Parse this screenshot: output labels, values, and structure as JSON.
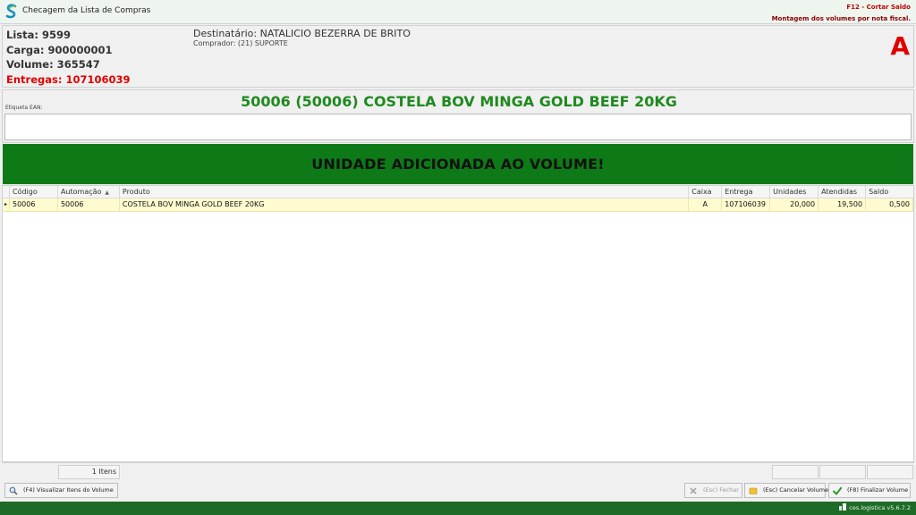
{
  "window": {
    "title": "Checagem da Lista de Compras",
    "hint_shortcut": "F12 - Cortar Saldo",
    "hint_mode": "Montagem dos volumes por nota fiscal."
  },
  "info": {
    "lista": "Lista: 9599",
    "carga": "Carga: 900000001",
    "volume": "Volume: 365547",
    "entregas": "Entregas: 107106039",
    "destinatario": "Destinatário: NATALICIO BEZERRA DE BRITO",
    "comprador": "Comprador: (21) SUPORTE",
    "box_letter": "A"
  },
  "product": {
    "title": "50006 (50006) COSTELA BOV MINGA GOLD BEEF 20KG",
    "ean_label": "Etiqueta EAN:",
    "ean_value": ""
  },
  "status": {
    "message": "UNIDADE ADICIONADA AO VOLUME!"
  },
  "grid": {
    "columns": [
      "Código",
      "Automação",
      "Produto",
      "Caixa",
      "Entrega",
      "Unidades",
      "Atendidas",
      "Saldo"
    ],
    "rows": [
      {
        "codigo": "50006",
        "automacao": "50006",
        "produto": "COSTELA BOV MINGA GOLD BEEF 20KG",
        "caixa": "A",
        "entrega": "107106039",
        "unidades": "20,000",
        "atendidas": "19,500",
        "saldo": "0,500"
      }
    ]
  },
  "summary": {
    "item_count": "1 Itens"
  },
  "buttons": {
    "view_items": "(F4) Visualizar Itens do Volume",
    "close": "(Esc) Fechar",
    "cancel_volume": "(Esc) Cancelar Volume",
    "finish_volume": "(F8) Finalizar Volume"
  },
  "footer": {
    "version": "ces.logistica v5.6.7.2"
  },
  "colors": {
    "accent_green": "#0e7a17",
    "product_green": "#1f8a1f",
    "alert_red": "#e00000",
    "row_highlight": "#fffbd0"
  },
  "icons": {
    "app_logo": "logo-s-icon",
    "view": "magnifier-icon",
    "close": "x-icon",
    "cancel": "folder-icon",
    "finish": "check-icon",
    "version": "app-icon"
  }
}
